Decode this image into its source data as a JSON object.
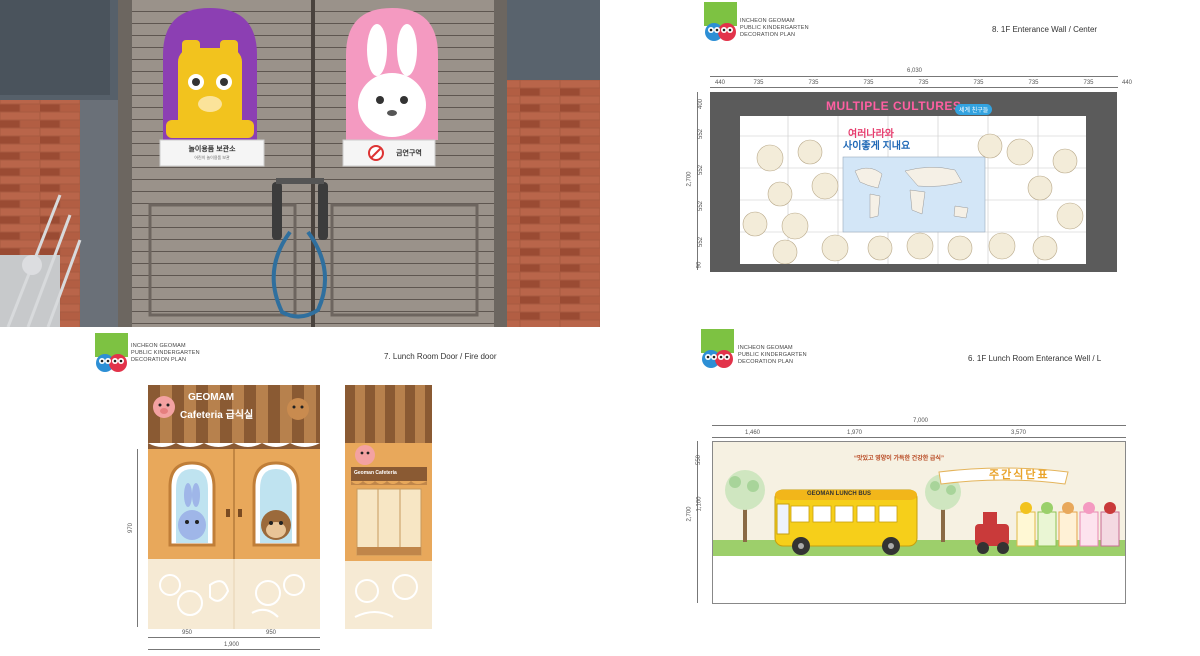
{
  "photo": {
    "sign_left": "놀이용품 보관소",
    "sign_left_sub": "어린이 놀이용품 보관",
    "sign_right": "금연구역"
  },
  "logo": {
    "line1": "INCHEON GEOMAM",
    "line2": "PUBLIC KINDERGARTEN",
    "line3": "DECORATION PLAN"
  },
  "wall_center": {
    "title": "8. 1F Enterance Wall / Center",
    "total_width": "6,030",
    "segments": [
      "440",
      "735",
      "735",
      "735",
      "735",
      "735",
      "735",
      "735",
      "440"
    ],
    "total_height": "2,700",
    "heights": [
      "400",
      "552",
      "552",
      "552",
      "552",
      "90"
    ],
    "banner": "MULTIPLE CULTURES",
    "banner_badge": "세계 친구들",
    "korean_line1": "여러나라와",
    "korean_line2": "사이좋게 지내요"
  },
  "door": {
    "title": "7. Lunch Room Door / Fire door",
    "sign_line1": "GEOMAM",
    "sign_line2": "Cafeteria 급식실",
    "side_sign": "Geoman Cafeteria",
    "height": "970",
    "left_width": "950",
    "right_width": "950",
    "total_width": "1,900"
  },
  "lunch_wall": {
    "title": "6. 1F Lunch Room Enterance Well / L",
    "total_width": "7,000",
    "segments": [
      "1,460",
      "1,970",
      "3,570"
    ],
    "total_height": "2,700",
    "heights": [
      "550",
      "1,100"
    ],
    "bus_label": "GEOMAN LUNCH BUS",
    "slogan": "“맛있고 영양이 가득한 건강한 급식”",
    "menu_title": "주간식단표"
  },
  "colors": {
    "purple": "#8c3fb3",
    "pink": "#f49ac1",
    "door_wood": "#d9a35c",
    "bus": "#f6cf1a",
    "grass": "#9dcf6b",
    "brick": "#a7533b"
  }
}
